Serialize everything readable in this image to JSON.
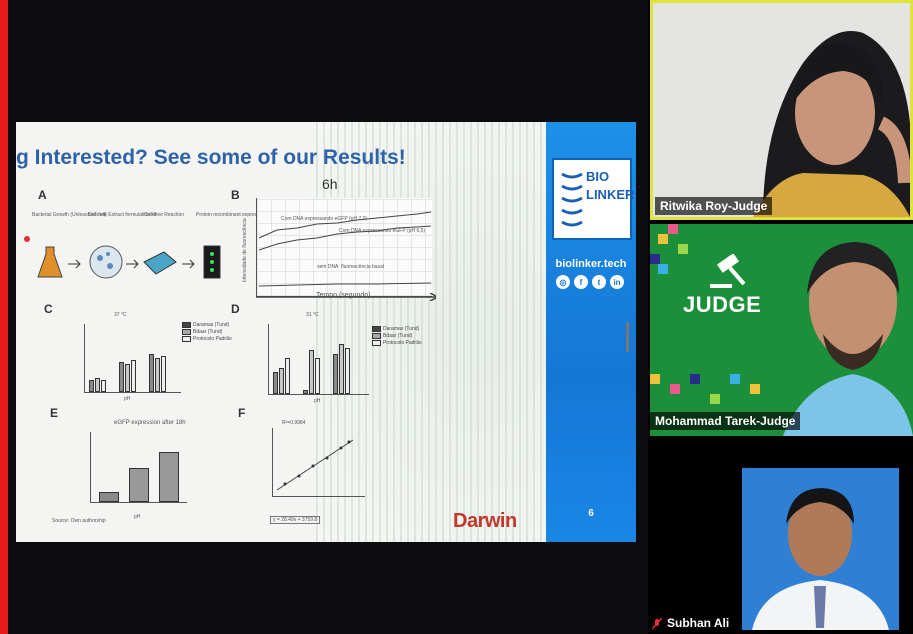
{
  "slide": {
    "title": "g Interested? See some of our Results!",
    "time_label": "6h",
    "panel_labels": [
      "A",
      "B",
      "C",
      "D",
      "E",
      "F"
    ],
    "panelA_steps": [
      "Bacterial Growth (Unleashed cell)",
      "Cell-free Extract formulation kit",
      "Cell-free Reaction",
      "Protein recombinant expression 6-18h"
    ],
    "panelB": {
      "ylabel": "Intensidade de fluorescência",
      "xlabel": "Tempo (segundo)",
      "annotations": [
        "Com DNA expressando eGFP (pH 7,0)",
        "Com DNA expressando eGFP (pH 6,5)",
        "sem DNA: fluorescência basal"
      ]
    },
    "panelC": {
      "temp": "37 °C",
      "legend": [
        "Daramas (Tund)",
        "Bdaar (Tund)",
        "Protocolo Padrão"
      ],
      "xlabel": "pH"
    },
    "panelD": {
      "temp": "31 °C",
      "legend": [
        "Daramas (Tund)",
        "Bdaar (Tund)",
        "Protocolo Padrão"
      ],
      "xlabel": "pH"
    },
    "panelE": {
      "title": "eGFP expression after 18h",
      "xlabel": "pH"
    },
    "panelF": {
      "r2": "R²=0.9984",
      "equation": "y = 28.49x + 3759.8"
    },
    "source": "Source: Own authorship",
    "brand": "Darwin"
  },
  "sidebar": {
    "logo_line1": "BIO",
    "logo_line2": "LINKER",
    "website": "biolinker.tech",
    "social_icons": [
      "instagram-icon",
      "facebook-icon",
      "twitter-icon",
      "linkedin-icon"
    ],
    "page_number": "6"
  },
  "participants": [
    {
      "name": "Ritwika Roy-Judge",
      "active_speaker": true
    },
    {
      "name": "Mohammad Tarek-Judge",
      "background_text": "JUDGE"
    },
    {
      "name": "Subhan Ali",
      "muted": true
    }
  ],
  "colors": {
    "active_speaker_border": "#dfe33a",
    "sidebar_blue": "#1477d6",
    "title_blue": "#2f63a8",
    "judge_green": "#1b8f39",
    "edge_red": "#e8181c"
  }
}
